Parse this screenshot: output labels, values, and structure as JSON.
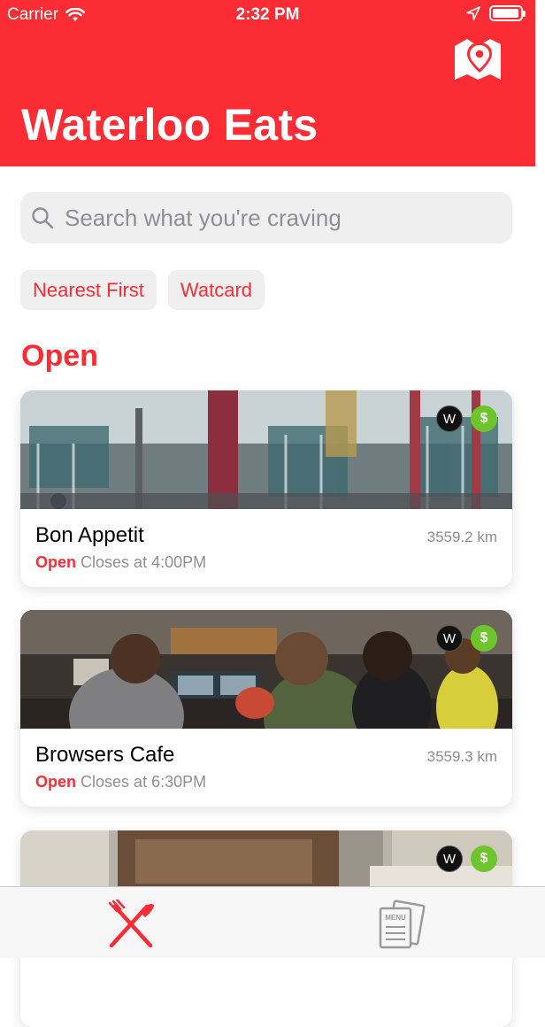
{
  "status_bar": {
    "carrier": "Carrier",
    "time": "2:32 PM"
  },
  "header": {
    "title": "Waterloo Eats",
    "background_color": "#fc2c35",
    "map_button_icon": "map-pin-icon"
  },
  "search": {
    "placeholder": "Search what you're craving"
  },
  "filters": [
    {
      "label": "Nearest First"
    },
    {
      "label": "Watcard"
    }
  ],
  "section": {
    "title": "Open"
  },
  "restaurants": [
    {
      "name": "Bon Appetit",
      "distance": "3559.2 km",
      "status": "Open",
      "hours": "Closes at 4:00PM",
      "badges": [
        "W",
        "$"
      ]
    },
    {
      "name": "Browsers Cafe",
      "distance": "3559.3 km",
      "status": "Open",
      "hours": "Closes at 6:30PM",
      "badges": [
        "W",
        "$"
      ]
    },
    {
      "badges": [
        "W",
        "$"
      ]
    }
  ],
  "tab_bar": {
    "tabs": [
      {
        "icon": "fork-knife-icon",
        "active": true
      },
      {
        "icon": "menu-icon",
        "active": false
      }
    ]
  },
  "colors": {
    "accent": "#fc2c35",
    "watcard_badge": "#6cc62b",
    "muted_text": "#8e8e93"
  }
}
